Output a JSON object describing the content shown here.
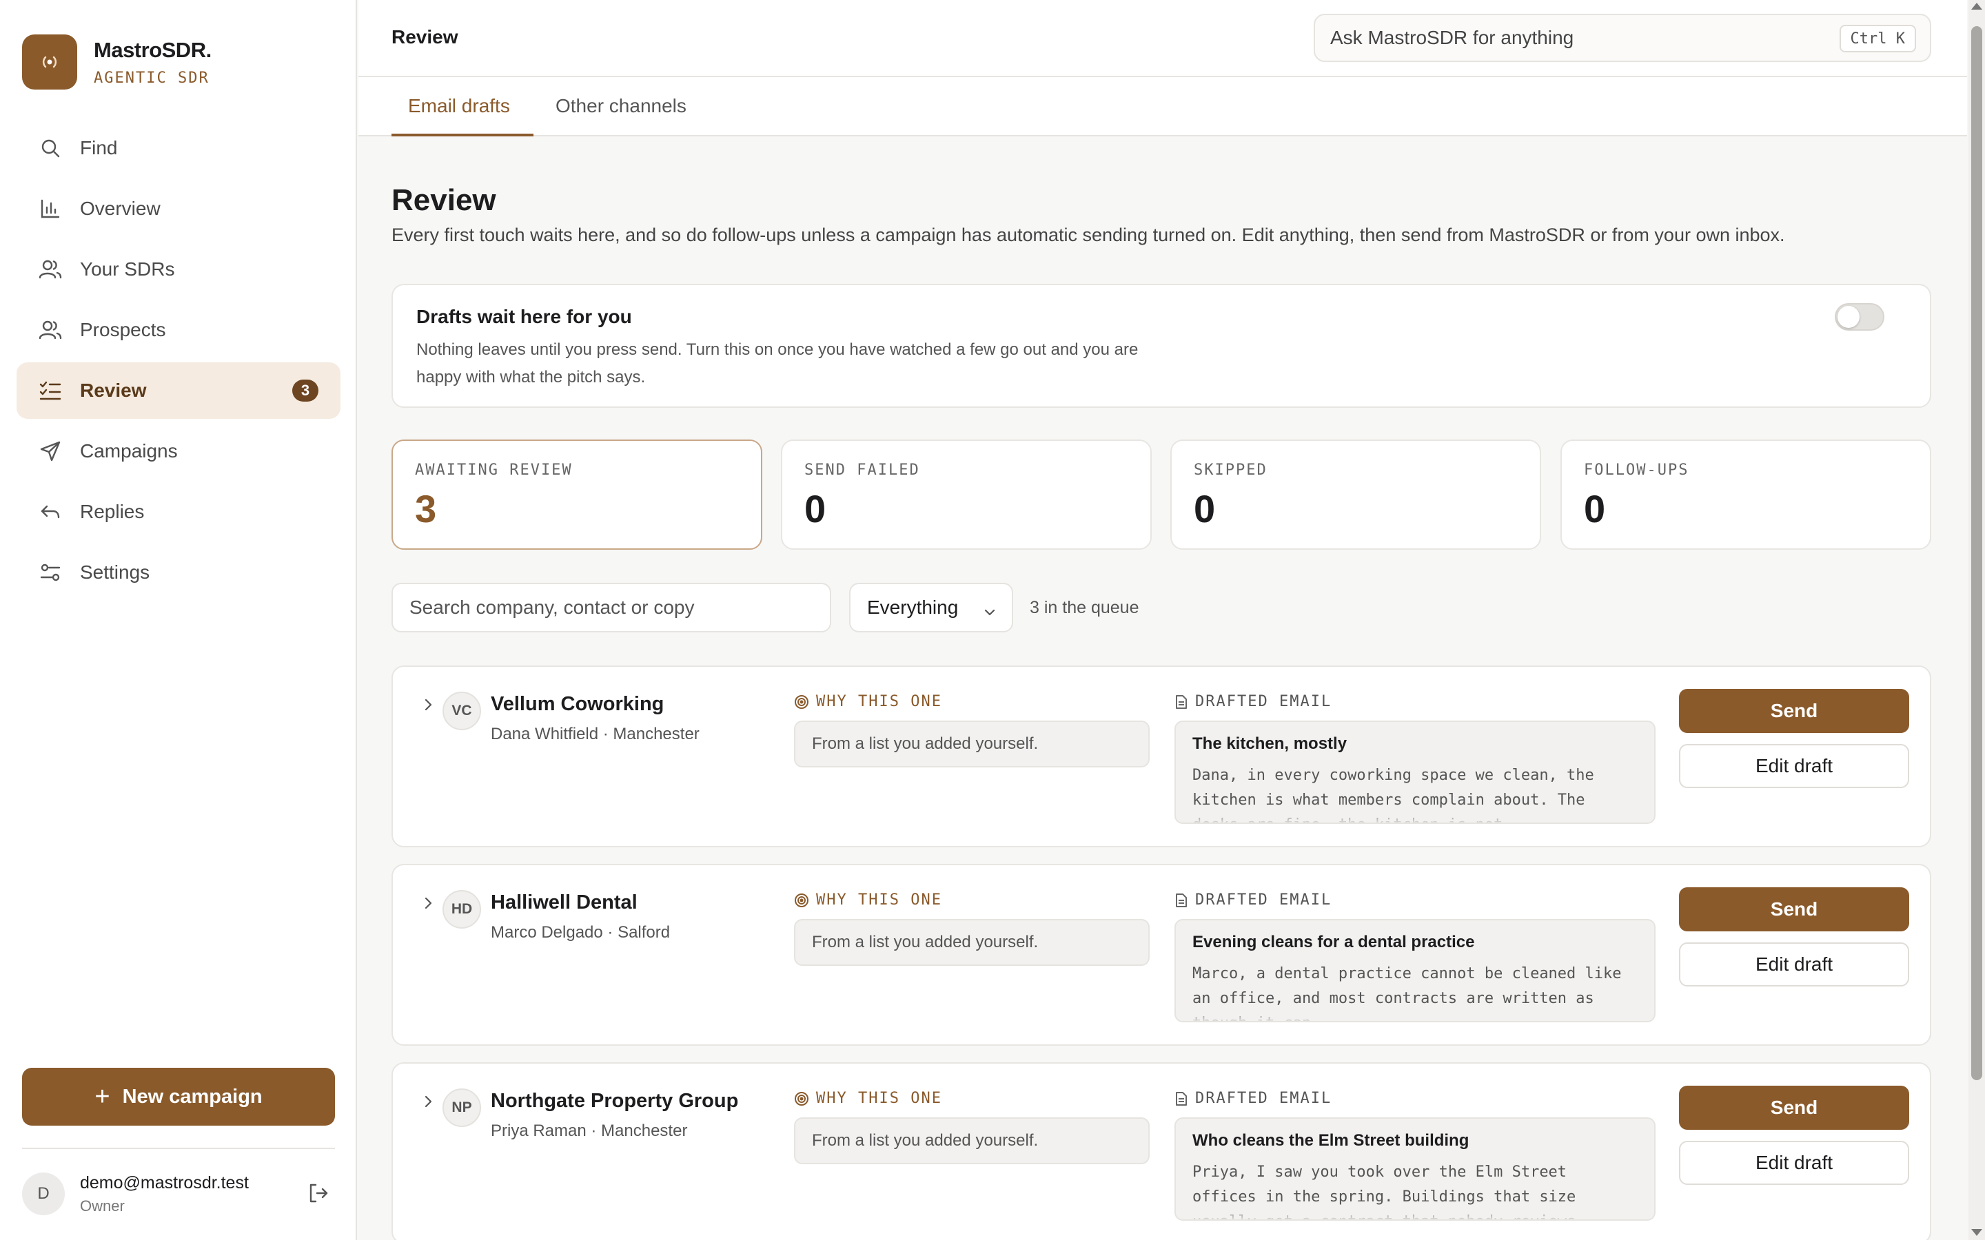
{
  "brand": {
    "name": "MastroSDR.",
    "subtitle": "AGENTIC SDR",
    "logo_icon": "signal-icon"
  },
  "nav": [
    {
      "label": "Find",
      "icon": "search-icon"
    },
    {
      "label": "Overview",
      "icon": "bar-chart-icon"
    },
    {
      "label": "Your SDRs",
      "icon": "users-icon"
    },
    {
      "label": "Prospects",
      "icon": "users-icon"
    },
    {
      "label": "Review",
      "icon": "checklist-icon",
      "badge": "3",
      "active": true
    },
    {
      "label": "Campaigns",
      "icon": "send-icon"
    },
    {
      "label": "Replies",
      "icon": "reply-icon"
    },
    {
      "label": "Settings",
      "icon": "sliders-icon"
    }
  ],
  "sidebar": {
    "new_campaign_label": "New campaign",
    "user": {
      "initial": "D",
      "email": "demo@mastrosdr.test",
      "role": "Owner"
    }
  },
  "topbar": {
    "title": "Review",
    "ask_placeholder": "Ask MastroSDR for anything",
    "shortcut": "Ctrl K"
  },
  "tabs": [
    {
      "label": "Email drafts",
      "active": true
    },
    {
      "label": "Other channels",
      "active": false
    }
  ],
  "page": {
    "title": "Review",
    "description": "Every first touch waits here, and so do follow-ups unless a campaign has automatic sending turned on. Edit anything, then send from MastroSDR or from your own inbox."
  },
  "auto_send": {
    "title": "Drafts wait here for you",
    "description": "Nothing leaves until you press send. Turn this on once you have watched a few go out and you are happy with what the pitch says.",
    "enabled": false
  },
  "stats": [
    {
      "label": "AWAITING REVIEW",
      "value": "3",
      "active": true
    },
    {
      "label": "SEND FAILED",
      "value": "0"
    },
    {
      "label": "SKIPPED",
      "value": "0"
    },
    {
      "label": "FOLLOW-UPS",
      "value": "0"
    }
  ],
  "filters": {
    "search_placeholder": "Search company, contact or copy",
    "select_value": "Everything",
    "queue_count": "3 in the queue"
  },
  "labels": {
    "why": "WHY THIS ONE",
    "drafted": "DRAFTED EMAIL",
    "send": "Send",
    "edit": "Edit draft"
  },
  "drafts": [
    {
      "initials": "VC",
      "company": "Vellum Coworking",
      "contact": "Dana Whitfield · Manchester",
      "why": "From a list you added yourself.",
      "subject": "The kitchen, mostly",
      "body": "Dana, in every coworking space we clean, the kitchen is what members complain about. The desks are fine, the kitchen is not."
    },
    {
      "initials": "HD",
      "company": "Halliwell Dental",
      "contact": "Marco Delgado · Salford",
      "why": "From a list you added yourself.",
      "subject": "Evening cleans for a dental practice",
      "body": "Marco, a dental practice cannot be cleaned like an office, and most contracts are written as though it can."
    },
    {
      "initials": "NP",
      "company": "Northgate Property Group",
      "contact": "Priya Raman · Manchester",
      "why": "From a list you added yourself.",
      "subject": "Who cleans the Elm Street building",
      "body": "Priya, I saw you took over the Elm Street offices in the spring. Buildings that size usually get a contract that nobody reviews."
    }
  ],
  "colors": {
    "accent": "#8a5a2b",
    "accent_light": "#f5ebe0",
    "badge": "#6e4521"
  }
}
